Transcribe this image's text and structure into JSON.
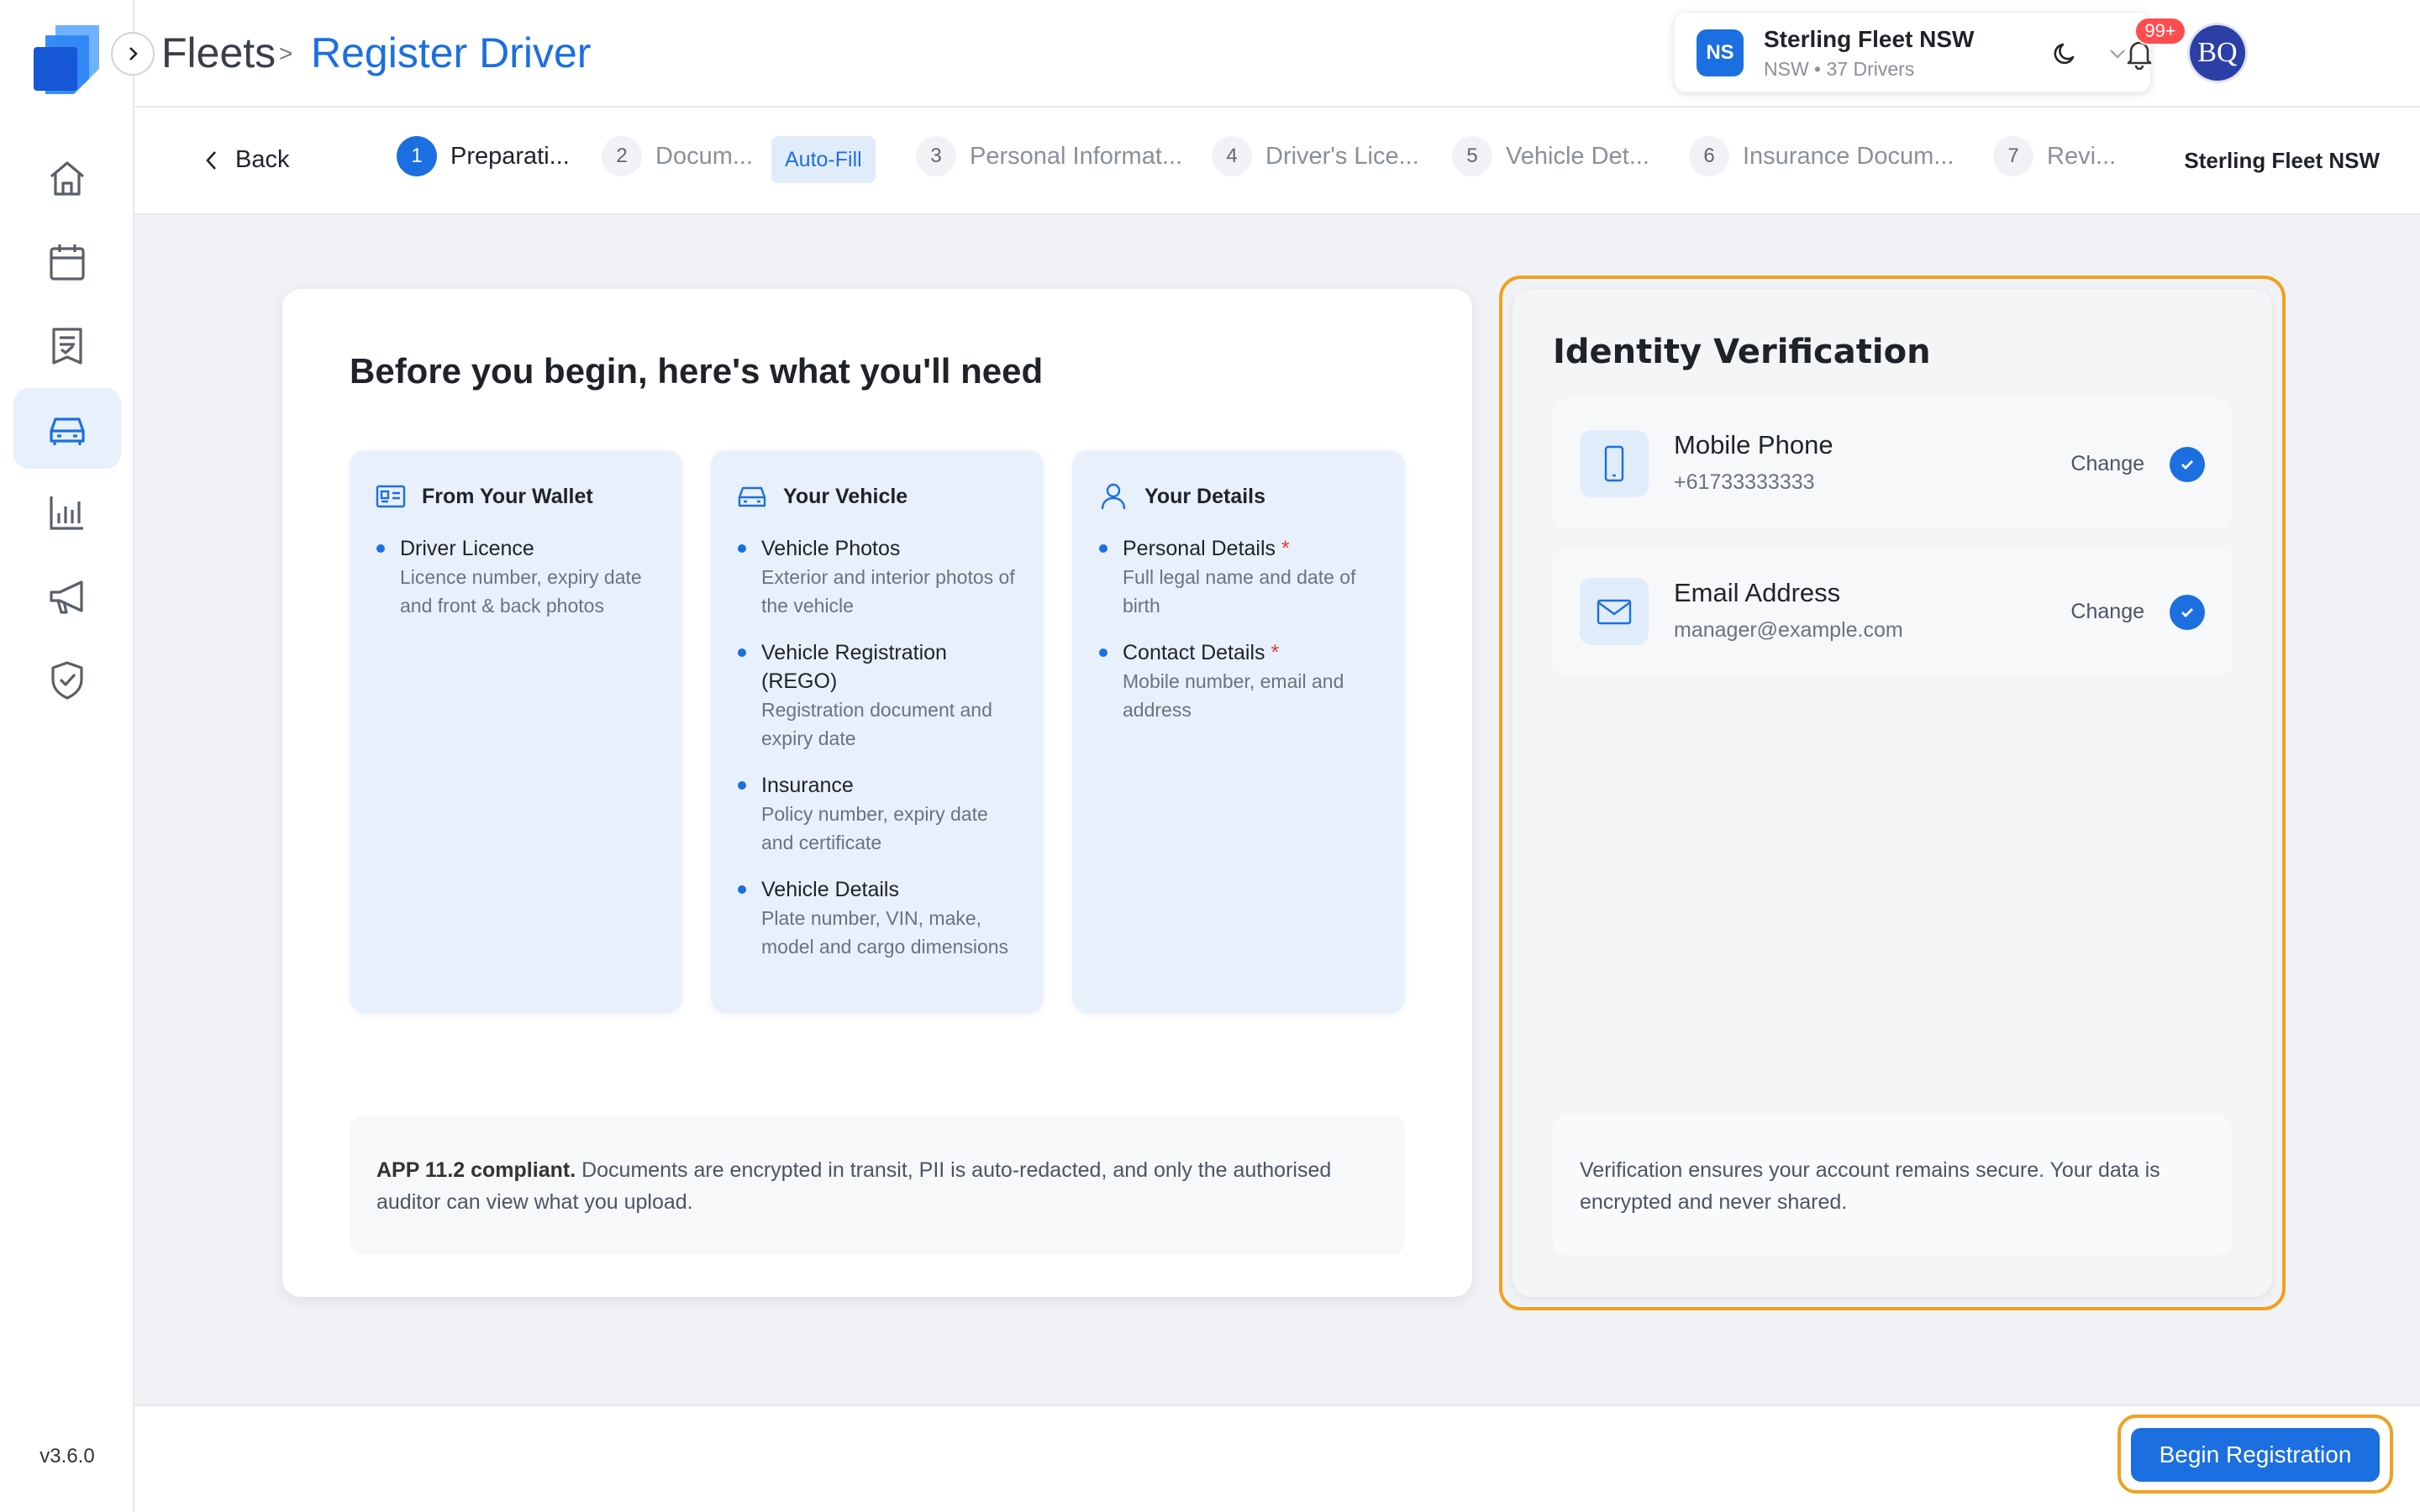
{
  "app": {
    "version": "v3.6.0"
  },
  "header": {
    "breadcrumb_root": "Fleets",
    "breadcrumb_separator": ">",
    "page_title": "Register Driver",
    "org": {
      "initials": "NS",
      "name": "Sterling Fleet NSW",
      "subtitle": "NSW • 37 Drivers"
    },
    "notifications_badge": "99+",
    "user_initials": "BQ"
  },
  "sidebar": {
    "items": [
      {
        "icon": "home-icon",
        "active": false
      },
      {
        "icon": "calendar-icon",
        "active": false
      },
      {
        "icon": "document-icon",
        "active": false
      },
      {
        "icon": "car-icon",
        "active": true
      },
      {
        "icon": "bar-chart-icon",
        "active": false
      },
      {
        "icon": "megaphone-icon",
        "active": false
      },
      {
        "icon": "shield-check-icon",
        "active": false
      }
    ]
  },
  "steps": {
    "back_label": "Back",
    "items": [
      {
        "num": "1",
        "label": "Preparati...",
        "active": true
      },
      {
        "num": "2",
        "label": "Docum...",
        "active": false
      },
      {
        "num": "3",
        "label": "Personal Informat...",
        "active": false
      },
      {
        "num": "4",
        "label": "Driver's Lice...",
        "active": false
      },
      {
        "num": "5",
        "label": "Vehicle Det...",
        "active": false
      },
      {
        "num": "6",
        "label": "Insurance Docum...",
        "active": false
      },
      {
        "num": "7",
        "label": "Revi...",
        "active": false
      }
    ],
    "autofill_label": "Auto-Fill",
    "org_label": "Sterling Fleet NSW"
  },
  "main": {
    "title": "Before you begin, here's what you'll need",
    "columns": [
      {
        "heading": "From Your Wallet",
        "icon": "id-card-icon",
        "items": [
          {
            "title": "Driver Licence",
            "required": false,
            "desc": "Licence number, expiry date and front & back photos"
          }
        ]
      },
      {
        "heading": "Your Vehicle",
        "icon": "car-icon",
        "items": [
          {
            "title": "Vehicle Photos",
            "required": false,
            "desc": "Exterior and interior photos of the vehicle"
          },
          {
            "title": "Vehicle Registration (REGO)",
            "required": false,
            "desc": "Registration document and expiry date"
          },
          {
            "title": "Insurance",
            "required": false,
            "desc": "Policy number, expiry date and certificate"
          },
          {
            "title": "Vehicle Details",
            "required": false,
            "desc": "Plate number, VIN, make, model and cargo dimensions"
          }
        ]
      },
      {
        "heading": "Your Details",
        "icon": "user-icon",
        "items": [
          {
            "title": "Personal Details",
            "required": true,
            "desc": "Full legal name and date of birth"
          },
          {
            "title": "Contact Details",
            "required": true,
            "desc": "Mobile number, email and address"
          }
        ]
      }
    ],
    "compliance_bold": "APP 11.2 compliant.",
    "compliance_text": " Documents are encrypted in transit, PII is auto-redacted, and only the authorised auditor can view what you upload."
  },
  "identity": {
    "title": "Identity Verification",
    "rows": [
      {
        "label": "Mobile Phone",
        "value": "+61733333333",
        "change": "Change",
        "icon": "phone-icon"
      },
      {
        "label": "Email Address",
        "value": "manager@example.com",
        "change": "Change",
        "icon": "mail-icon"
      }
    ],
    "note": "Verification ensures your account remains secure. Your data is encrypted and never shared."
  },
  "footer": {
    "begin_label": "Begin Registration"
  },
  "colors": {
    "accent": "#1b6fe0",
    "highlight": "#f0a020",
    "required": "#e53935"
  }
}
